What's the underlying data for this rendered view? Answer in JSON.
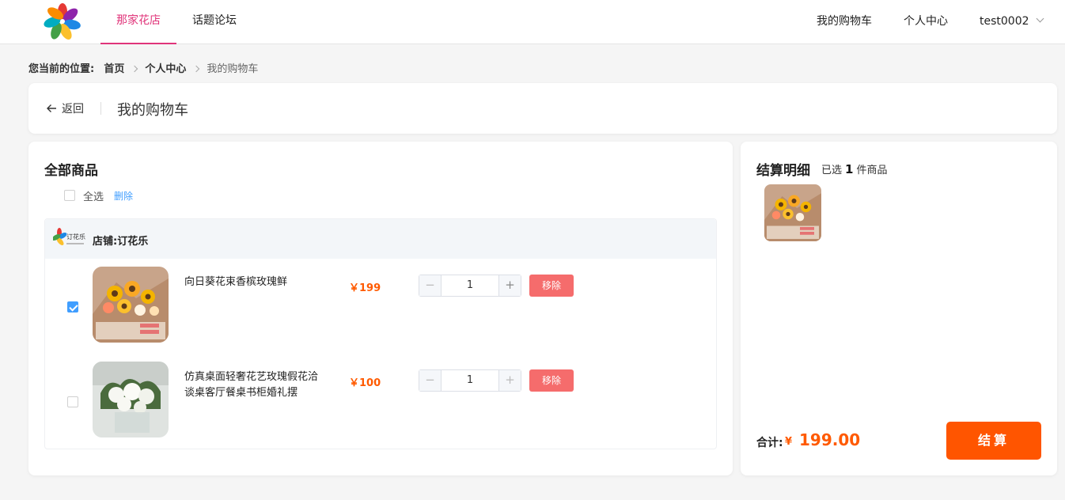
{
  "header": {
    "nav": [
      {
        "label": "那家花店",
        "active": true
      },
      {
        "label": "话题论坛",
        "active": false
      }
    ],
    "right": {
      "cart": "我的购物车",
      "profile": "个人中心",
      "username": "test0002"
    }
  },
  "breadcrumb": {
    "prefix": "您当前的位置:",
    "items": [
      "首页",
      "个人中心",
      "我的购物车"
    ]
  },
  "title_bar": {
    "back_label": "返回",
    "title": "我的购物车"
  },
  "products": {
    "heading": "全部商品",
    "select_all_label": "全选",
    "delete_label": "删除",
    "shop_name": "店铺:订花乐",
    "shop_logo_text": "订花乐",
    "items": [
      {
        "name": "向日葵花束香槟玫瑰鲜",
        "price": "￥199",
        "quantity": "1",
        "remove_label": "移除",
        "checked": true
      },
      {
        "name": "仿真桌面轻奢花艺玫瑰假花洽谈桌客厅餐桌书柜婚礼摆",
        "price": "￥100",
        "quantity": "1",
        "remove_label": "移除",
        "checked": false
      }
    ]
  },
  "summary": {
    "title": "结算明细",
    "selected_prefix": "已选",
    "selected_count": "1",
    "selected_suffix": "件商品",
    "total_label": "合计:",
    "currency": "¥",
    "total_value": "199.00",
    "checkout_label": "结算"
  },
  "colors": {
    "brand_pink": "#e0347a",
    "price_orange": "#ff5a00",
    "checkout_orange": "#ff5500",
    "remove_red": "#f56c6c",
    "link_blue": "#409eff"
  }
}
